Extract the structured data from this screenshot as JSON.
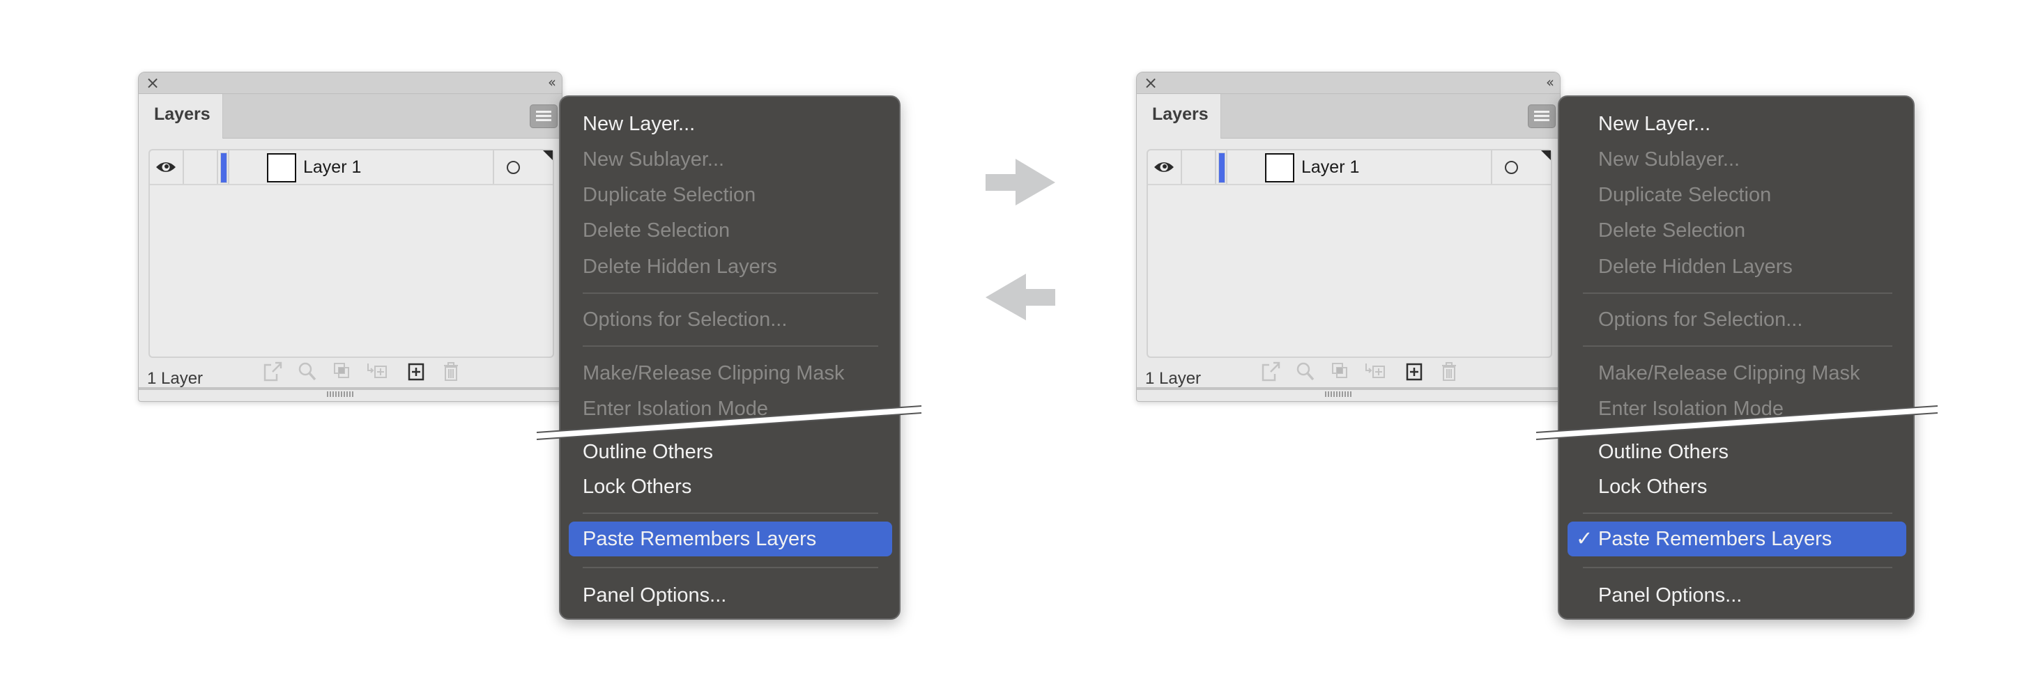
{
  "colors": {
    "menu_bg": "#494846",
    "menu_highlight": "#4169d2",
    "layer_color": "#4a6be6",
    "arrow": "#cbcccd"
  },
  "panels": [
    {
      "side": "before",
      "title_controls": {
        "close_icon": "×",
        "collapse_icon": "‹‹"
      },
      "tab_label": "Layers",
      "layers": [
        {
          "name": "Layer 1",
          "visible": true,
          "locked": false
        }
      ],
      "footer_label": "1 Layer",
      "footer_icons": [
        "export-icon",
        "locate-object-icon",
        "make-clipping-mask-icon",
        "move-to-layer-icon",
        "new-layer-icon",
        "trash-icon"
      ]
    },
    {
      "side": "after",
      "title_controls": {
        "close_icon": "×",
        "collapse_icon": "‹‹"
      },
      "tab_label": "Layers",
      "layers": [
        {
          "name": "Layer 1",
          "visible": true,
          "locked": false
        }
      ],
      "footer_label": "1 Layer",
      "footer_icons": [
        "export-icon",
        "locate-object-icon",
        "make-clipping-mask-icon",
        "move-to-layer-icon",
        "new-layer-icon",
        "trash-icon"
      ]
    }
  ],
  "menus": [
    {
      "items": [
        {
          "label": "New Layer...",
          "enabled": true
        },
        {
          "label": "New Sublayer...",
          "enabled": false
        },
        {
          "label": "Duplicate Selection",
          "enabled": false
        },
        {
          "label": "Delete Selection",
          "enabled": false
        },
        {
          "label": "Delete Hidden Layers",
          "enabled": false
        },
        {
          "label": "Options for Selection...",
          "enabled": false
        },
        {
          "label": "Make/Release Clipping Mask",
          "enabled": false
        },
        {
          "label": "Enter Isolation Mode",
          "enabled": false
        },
        {
          "label": "Outline Others",
          "enabled": true
        },
        {
          "label": "Lock Others",
          "enabled": true
        },
        {
          "label": "Paste Remembers Layers",
          "enabled": true,
          "highlighted": true,
          "checked": false
        },
        {
          "label": "Panel Options...",
          "enabled": true
        }
      ]
    },
    {
      "items": [
        {
          "label": "New Layer...",
          "enabled": true
        },
        {
          "label": "New Sublayer...",
          "enabled": false
        },
        {
          "label": "Duplicate Selection",
          "enabled": false
        },
        {
          "label": "Delete Selection",
          "enabled": false
        },
        {
          "label": "Delete Hidden Layers",
          "enabled": false
        },
        {
          "label": "Options for Selection...",
          "enabled": false
        },
        {
          "label": "Make/Release Clipping Mask",
          "enabled": false
        },
        {
          "label": "Enter Isolation Mode",
          "enabled": false
        },
        {
          "label": "Outline Others",
          "enabled": true
        },
        {
          "label": "Lock Others",
          "enabled": true
        },
        {
          "label": "Paste Remembers Layers",
          "enabled": true,
          "highlighted": true,
          "checked": true,
          "check_glyph": "✓"
        },
        {
          "label": "Panel Options...",
          "enabled": true
        }
      ]
    }
  ],
  "transition_arrows": [
    "arrow-right-icon",
    "arrow-left-icon"
  ]
}
